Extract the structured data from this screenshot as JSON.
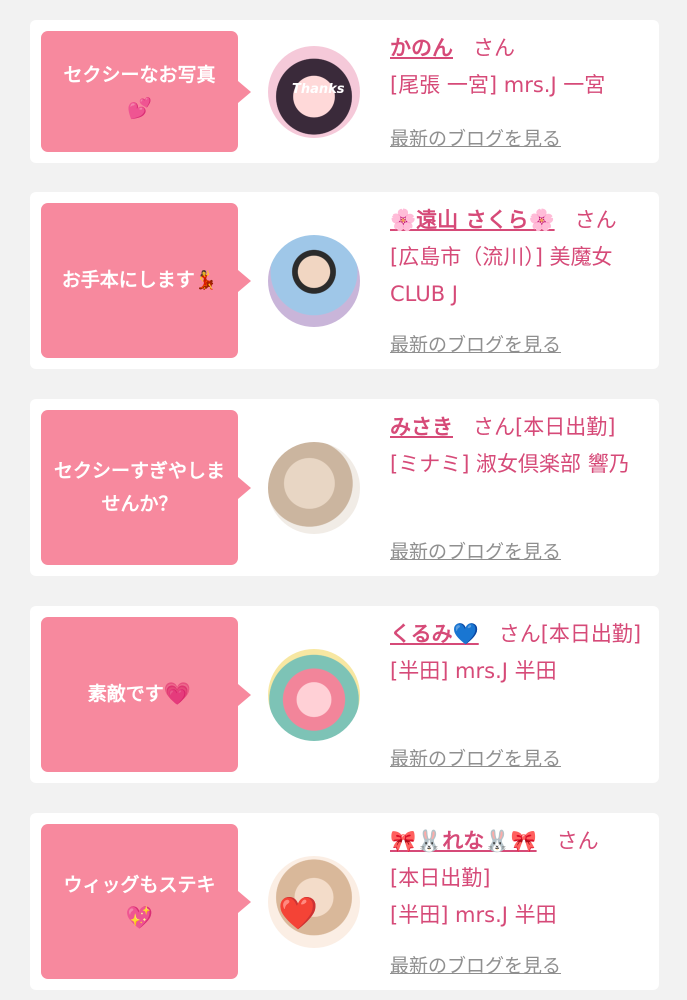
{
  "honorific": "さん",
  "blog_link_label": "最新のブログを見る",
  "items": [
    {
      "comment": "セクシーなお写真",
      "comment_emoji": "💕",
      "name": "かのん",
      "status": "",
      "shop": "[尾張 一宮] mrs.J 一宮",
      "avatar_text": "Thanks"
    },
    {
      "comment": "お手本にします",
      "comment_emoji": "💃",
      "name": "🌸遠山 さくら🌸",
      "status": "",
      "shop": "[広島市（流川）] 美魔女CLUB J"
    },
    {
      "comment": "セクシーすぎやしませんか？",
      "comment_emoji": "",
      "name": "みさき",
      "status": "[本日出勤]",
      "shop": "[ミナミ] 淑女倶楽部 響乃"
    },
    {
      "comment": "素敵です",
      "comment_emoji": "💗",
      "name": "くるみ💙",
      "status": "[本日出勤]",
      "shop": "[半田] mrs.J 半田"
    },
    {
      "comment": "ウィッグもステキ",
      "comment_emoji": "💖",
      "name": "🎀🐰れな🐰🎀",
      "status": "[本日出勤]",
      "shop": "[半田] mrs.J 半田",
      "avatar_emoji": "❤️"
    }
  ]
}
